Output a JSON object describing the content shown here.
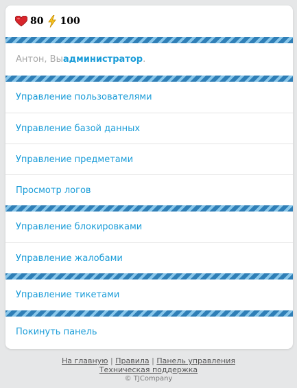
{
  "stats": {
    "health": "80",
    "energy": "100"
  },
  "welcome": {
    "prefix": "Антон, Вы ",
    "role": "администратор",
    "suffix": "."
  },
  "menu": {
    "group1": [
      "Управление пользователями",
      "Управление базой данных",
      "Управление предметами",
      "Просмотр логов"
    ],
    "group2": [
      "Управление блокировками",
      "Управление жалобами"
    ],
    "group3": [
      "Управление тикетами"
    ],
    "group4": [
      "Покинуть панель"
    ]
  },
  "footer": {
    "links": [
      "На главную",
      "Правила",
      "Панель управления"
    ],
    "separator": "|",
    "support": "Техническая поддержка",
    "copyright": "© TJCompany"
  },
  "colors": {
    "accent": "#1a9cd8",
    "stripe_dark": "#2f7fb7",
    "stripe_light": "#88c6ea",
    "background": "#e6e7e8"
  },
  "icons": {
    "health": "heart-icon",
    "energy": "lightning-icon"
  }
}
